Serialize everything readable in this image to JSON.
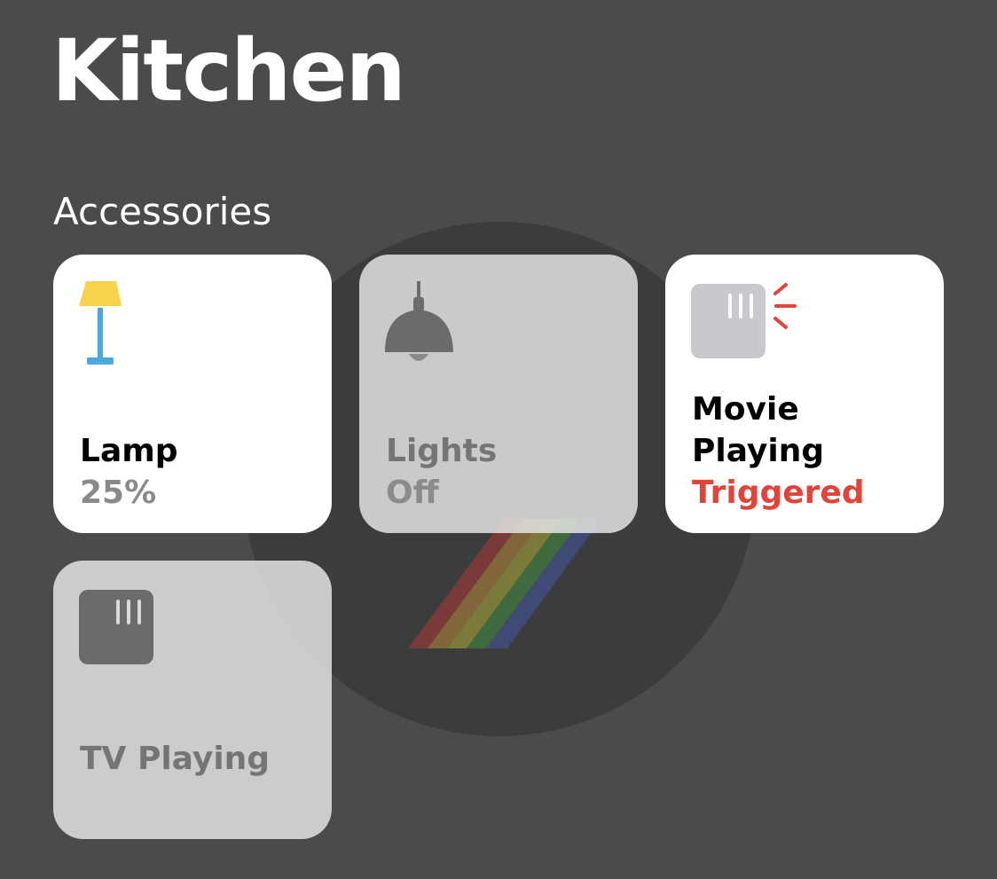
{
  "header": {
    "title": "Kitchen",
    "section": "Accessories"
  },
  "colors": {
    "background": "#4b4b4b",
    "tile_on": "#ffffff",
    "tile_off": "#e2e2e2",
    "lamp_shade": "#f8d24a",
    "lamp_stand": "#4aa8dd",
    "triggered": "#e3443a"
  },
  "accessories": [
    {
      "name": "Lamp",
      "status": "25%",
      "state": "on",
      "icon": "floor-lamp-icon"
    },
    {
      "name": "Lights",
      "status": "Off",
      "state": "off",
      "icon": "pendant-light-icon"
    },
    {
      "name": "Movie Playing",
      "status": "Triggered",
      "state": "on",
      "icon": "tv-sensor-icon"
    },
    {
      "name": "TV Playing",
      "status": "",
      "state": "off",
      "icon": "tv-sensor-icon"
    }
  ]
}
